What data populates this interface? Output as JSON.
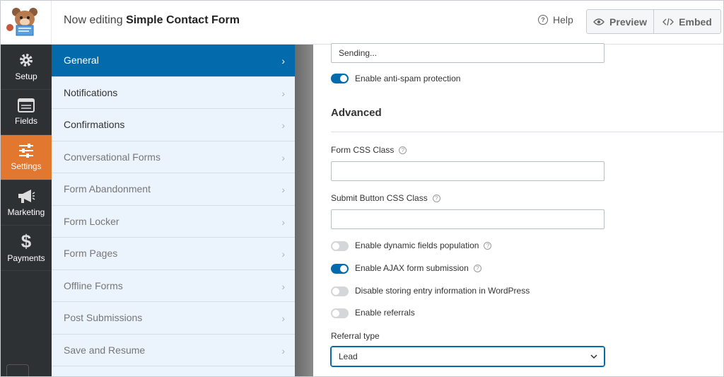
{
  "header": {
    "editing_prefix": "Now editing",
    "form_name": "Simple Contact Form",
    "help_label": "Help",
    "preview_label": "Preview",
    "embed_label": "Embed"
  },
  "sidebar": {
    "items": [
      {
        "label": "Setup",
        "icon": "gear-icon"
      },
      {
        "label": "Fields",
        "icon": "fields-icon"
      },
      {
        "label": "Settings",
        "icon": "sliders-icon"
      },
      {
        "label": "Marketing",
        "icon": "megaphone-icon"
      },
      {
        "label": "Payments",
        "icon": "dollar-icon"
      }
    ],
    "active": "Settings"
  },
  "settings_menu": {
    "items": [
      {
        "label": "General"
      },
      {
        "label": "Notifications"
      },
      {
        "label": "Confirmations"
      },
      {
        "label": "Conversational Forms"
      },
      {
        "label": "Form Abandonment"
      },
      {
        "label": "Form Locker"
      },
      {
        "label": "Form Pages"
      },
      {
        "label": "Offline Forms"
      },
      {
        "label": "Post Submissions"
      },
      {
        "label": "Save and Resume"
      }
    ],
    "active": "General"
  },
  "content": {
    "submit_processing_text": "Sending...",
    "anti_spam_label": "Enable anti-spam protection",
    "advanced_heading": "Advanced",
    "form_css_class_label": "Form CSS Class",
    "form_css_class_value": "",
    "submit_css_class_label": "Submit Button CSS Class",
    "submit_css_class_value": "",
    "dynamic_fields_label": "Enable dynamic fields population",
    "ajax_label": "Enable AJAX form submission",
    "disable_storing_label": "Disable storing entry information in WordPress",
    "referrals_label": "Enable referrals",
    "referral_type_label": "Referral type",
    "referral_type_value": "Lead"
  },
  "colors": {
    "accent_blue": "#036aab",
    "active_orange": "#e27730",
    "sidebar_dark": "#2d3134",
    "panel_bg": "#ebf3fc"
  }
}
